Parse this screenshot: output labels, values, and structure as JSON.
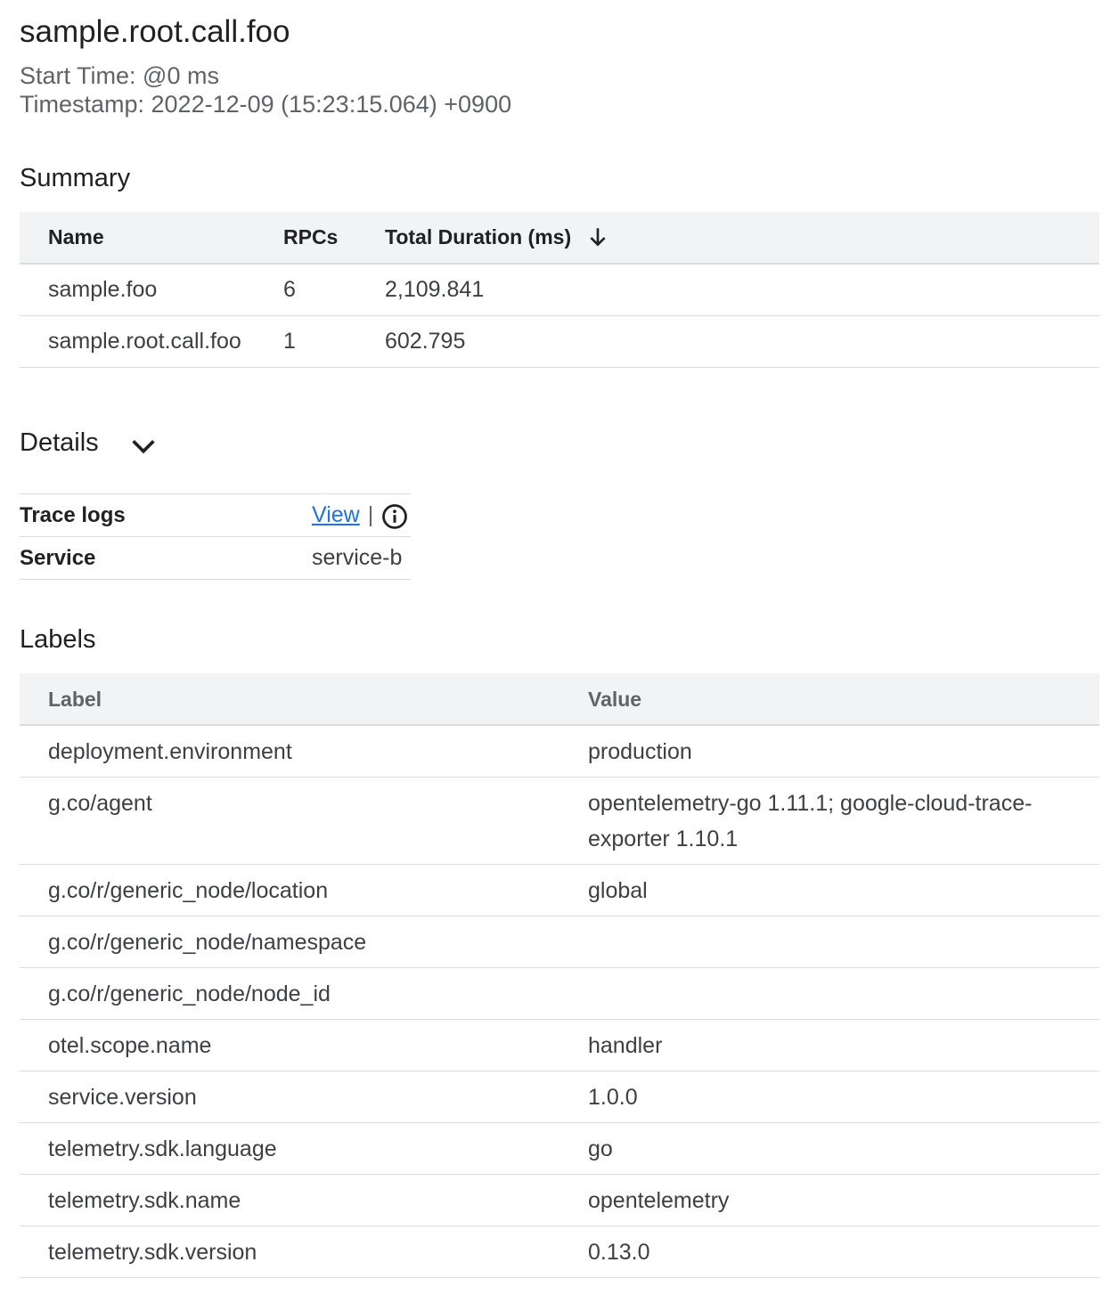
{
  "header": {
    "title": "sample.root.call.foo",
    "start_time": "Start Time: @0 ms",
    "timestamp": "Timestamp: 2022-12-09 (15:23:15.064) +0900"
  },
  "summary": {
    "heading": "Summary",
    "columns": {
      "name": "Name",
      "rpcs": "RPCs",
      "duration": "Total Duration (ms)"
    },
    "sort_icon": "arrow-down-icon",
    "rows": [
      {
        "name": "sample.foo",
        "rpcs": "6",
        "duration": "2,109.841"
      },
      {
        "name": "sample.root.call.foo",
        "rpcs": "1",
        "duration": "602.795"
      }
    ]
  },
  "details": {
    "heading": "Details",
    "toggle_icon": "chevron-down-icon",
    "trace_logs_label": "Trace logs",
    "trace_logs_link": "View",
    "trace_logs_sep": "|",
    "info_icon": "info-icon",
    "service_label": "Service",
    "service_value": "service-b"
  },
  "labels": {
    "heading": "Labels",
    "columns": {
      "label": "Label",
      "value": "Value"
    },
    "rows": [
      {
        "label": "deployment.environment",
        "value": "production"
      },
      {
        "label": "g.co/agent",
        "value": "opentelemetry-go 1.11.1; google-cloud-trace-exporter 1.10.1"
      },
      {
        "label": "g.co/r/generic_node/location",
        "value": "global"
      },
      {
        "label": "g.co/r/generic_node/namespace",
        "value": ""
      },
      {
        "label": "g.co/r/generic_node/node_id",
        "value": ""
      },
      {
        "label": "otel.scope.name",
        "value": "handler"
      },
      {
        "label": "service.version",
        "value": "1.0.0"
      },
      {
        "label": "telemetry.sdk.language",
        "value": "go"
      },
      {
        "label": "telemetry.sdk.name",
        "value": "opentelemetry"
      },
      {
        "label": "telemetry.sdk.version",
        "value": "0.13.0"
      }
    ]
  }
}
